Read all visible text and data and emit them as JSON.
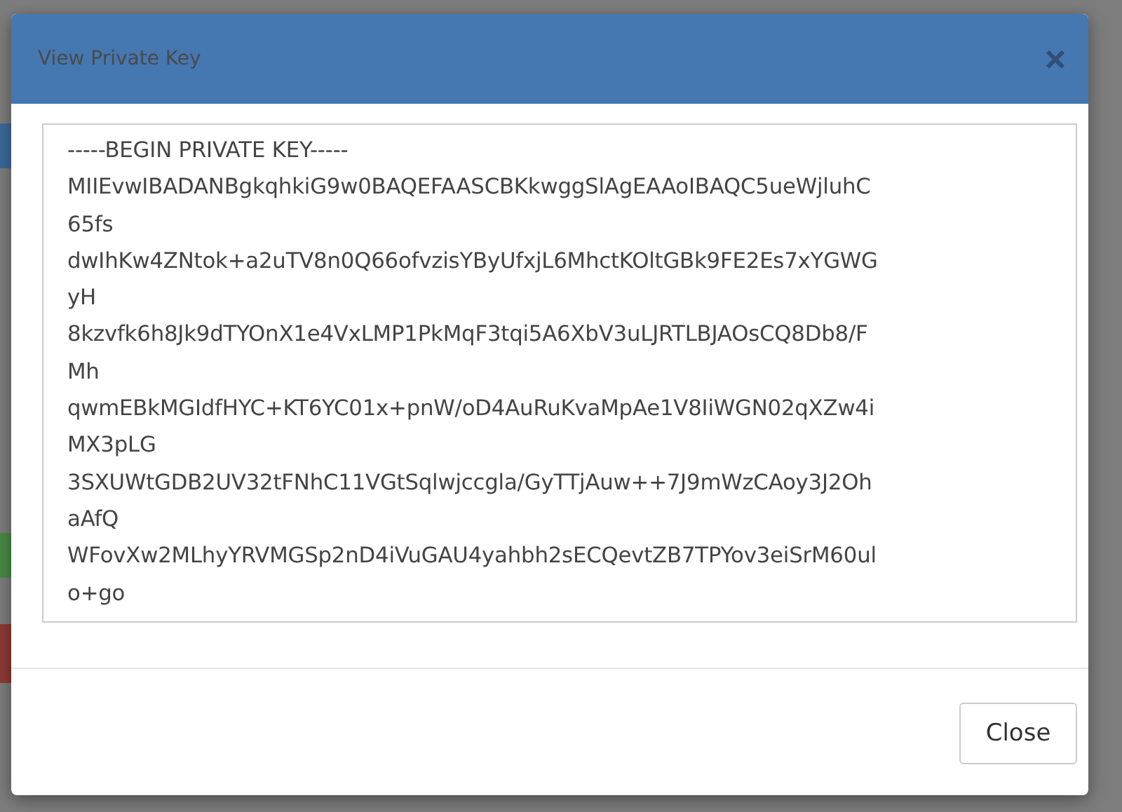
{
  "dialog": {
    "title": "View Private Key",
    "close_icon": "×",
    "key_lines": [
      "-----BEGIN PRIVATE KEY-----",
      "MIIEvwIBADANBgkqhkiG9w0BAQEFAASCBKkwggSlAgEAAoIBAQC5ueWjluhC",
      "65fs",
      "dwIhKw4ZNtok+a2uTV8n0Q66ofvzisYByUfxjL6MhctKOltGBk9FE2Es7xYGWG",
      "yH",
      "8kzvfk6h8Jk9dTYOnX1e4VxLMP1PkMqF3tqi5A6XbV3uLJRTLBJAOsCQ8Db8/F",
      "Mh",
      "qwmEBkMGIdfHYC+KT6YC01x+pnW/oD4AuRuKvaMpAe1V8IiWGN02qXZw4i",
      "MX3pLG",
      "3SXUWtGDB2UV32tFNhC11VGtSqlwjccgla/GyTTjAuw++7J9mWzCAoy3J2Oh",
      "aAfQ",
      "WFovXw2MLhyYRVMGSp2nD4iVuGAU4yahbh2sECQevtZB7TPYov3eiSrM60ul",
      "o+go"
    ],
    "buttons": [
      "Close"
    ]
  }
}
